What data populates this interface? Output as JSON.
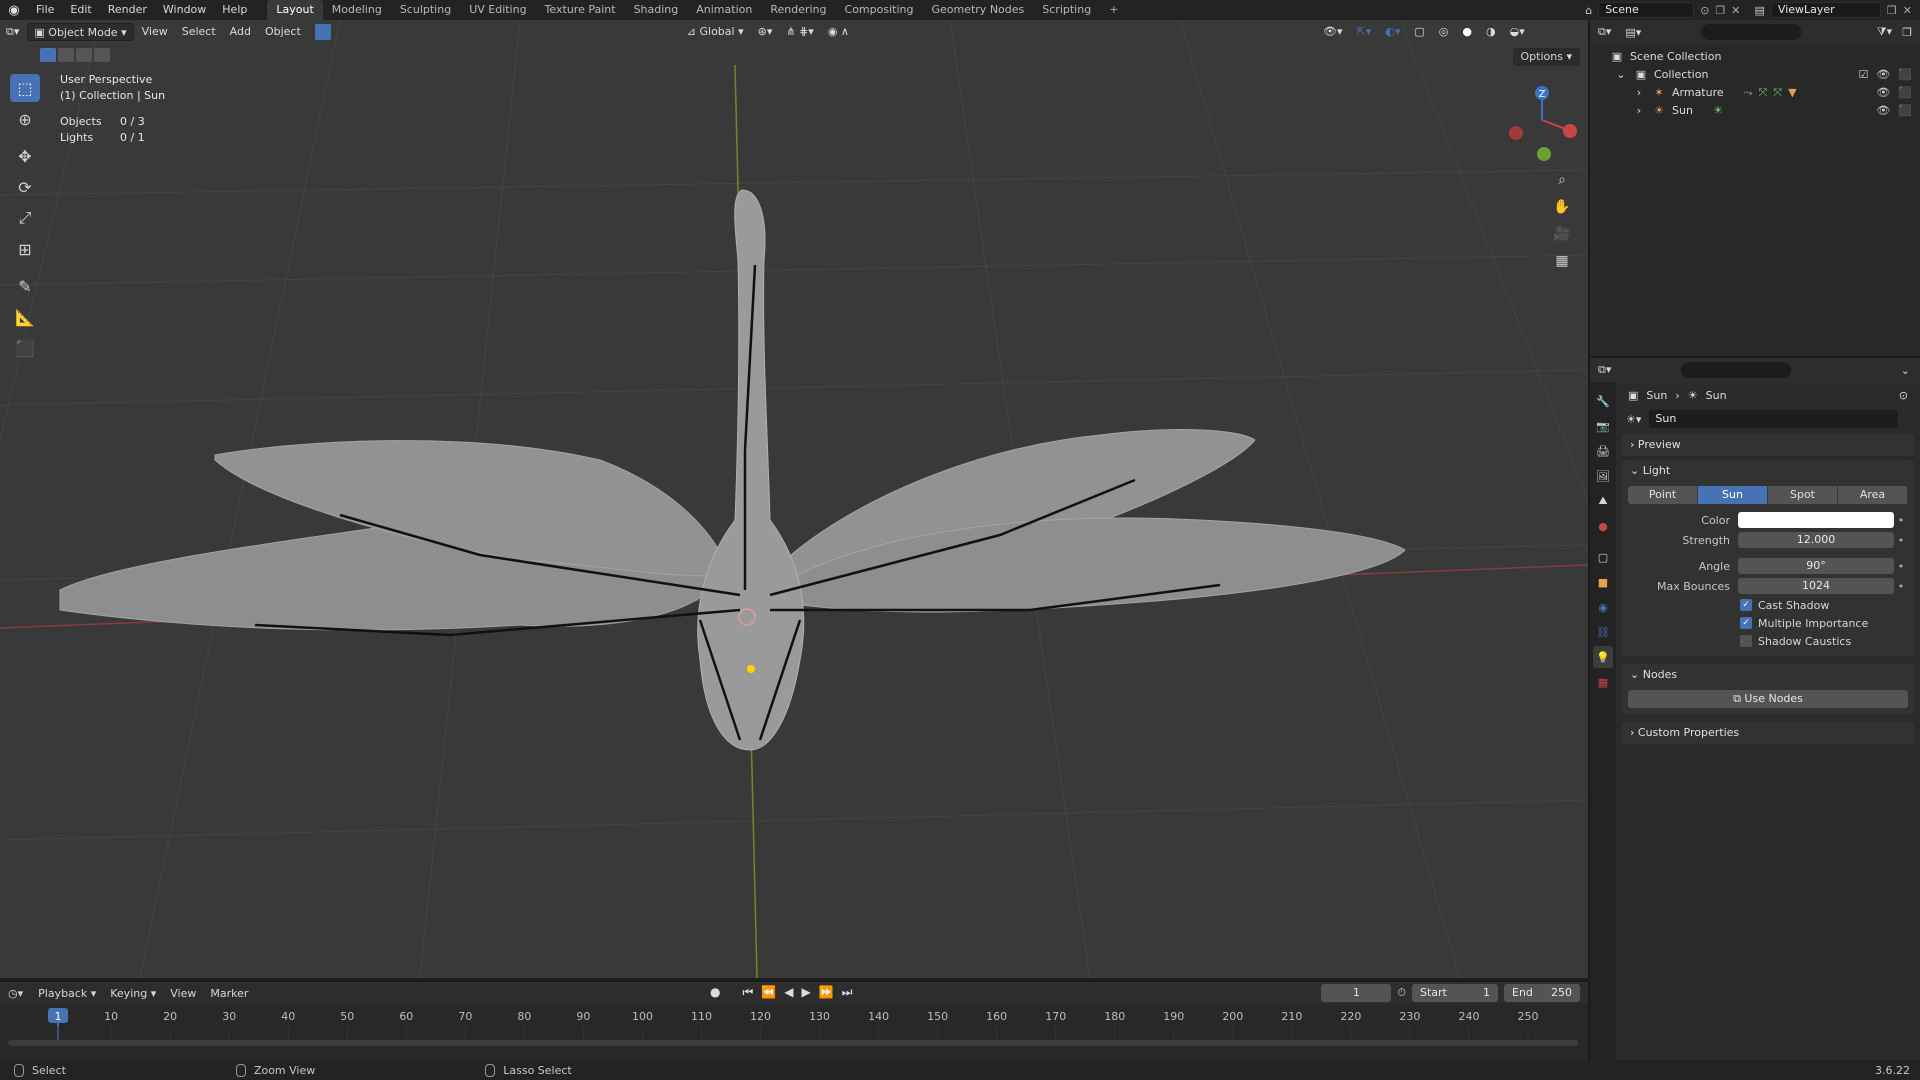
{
  "topbar": {
    "menu": [
      "File",
      "Edit",
      "Render",
      "Window",
      "Help"
    ],
    "workspaces": [
      "Layout",
      "Modeling",
      "Sculpting",
      "UV Editing",
      "Texture Paint",
      "Shading",
      "Animation",
      "Rendering",
      "Compositing",
      "Geometry Nodes",
      "Scripting"
    ],
    "active_workspace": "Layout",
    "scene": "Scene",
    "view_layer": "ViewLayer"
  },
  "viewport": {
    "mode": "Object Mode",
    "menu": [
      "View",
      "Select",
      "Add",
      "Object"
    ],
    "orientation": "Global",
    "options": "Options",
    "overlay": {
      "view_name": "User Perspective",
      "collection": "(1) Collection | Sun",
      "objects_label": "Objects",
      "objects_value": "0 / 3",
      "lights_label": "Lights",
      "lights_value": "0 / 1"
    },
    "gizmo_z": "Z"
  },
  "outliner": {
    "scene_collection": "Scene Collection",
    "collection": "Collection",
    "items": [
      {
        "name": "Armature"
      },
      {
        "name": "Sun"
      }
    ]
  },
  "properties": {
    "breadcrumb_object": "Sun",
    "breadcrumb_data": "Sun",
    "data_name": "Sun",
    "preview_label": "Preview",
    "light_label": "Light",
    "light_types": [
      "Point",
      "Sun",
      "Spot",
      "Area"
    ],
    "active_type": "Sun",
    "color_label": "Color",
    "color_value": "#ffffff",
    "strength_label": "Strength",
    "strength_value": "12.000",
    "angle_label": "Angle",
    "angle_value": "90°",
    "max_bounces_label": "Max Bounces",
    "max_bounces_value": "1024",
    "cast_shadow": "Cast Shadow",
    "multiple_importance": "Multiple Importance",
    "shadow_caustics": "Shadow Caustics",
    "nodes_label": "Nodes",
    "use_nodes": "Use Nodes",
    "custom_properties": "Custom Properties"
  },
  "timeline": {
    "menu": [
      "Playback",
      "Keying",
      "View",
      "Marker"
    ],
    "current_frame": "1",
    "start_label": "Start",
    "start_value": "1",
    "end_label": "End",
    "end_value": "250",
    "ticks": [
      "1",
      "10",
      "20",
      "30",
      "40",
      "50",
      "60",
      "70",
      "80",
      "90",
      "100",
      "110",
      "120",
      "130",
      "140",
      "150",
      "160",
      "170",
      "180",
      "190",
      "200",
      "210",
      "220",
      "230",
      "240",
      "250"
    ]
  },
  "statusbar": {
    "select": "Select",
    "zoom_view": "Zoom View",
    "lasso_select": "Lasso Select",
    "version": "3.6.22"
  },
  "colors": {
    "accent": "#4772b3",
    "viewport_bg": "#393939",
    "x_axis": "#c0393b",
    "y_axis": "#7aa02c"
  }
}
